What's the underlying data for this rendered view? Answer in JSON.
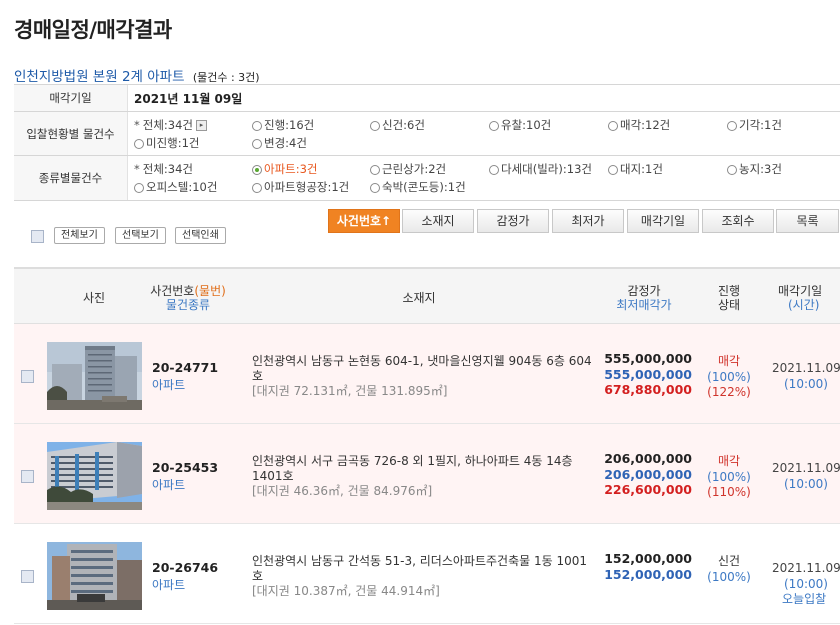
{
  "page_title": "경매일정/매각결과",
  "court": {
    "name": "인천지방법원 본원 2계 아파트",
    "count_note": "(물건수 : 3건)"
  },
  "filters": {
    "date_label": "매각기일",
    "date_value": "2021년 11월 09일",
    "status_label": "입찰현황별 물건수",
    "status_options": [
      {
        "label": "전체:34건",
        "kind": "total"
      },
      {
        "label": "진행:16건",
        "kind": "radio"
      },
      {
        "label": "신건:6건",
        "kind": "radio"
      },
      {
        "label": "유찰:10건",
        "kind": "radio"
      },
      {
        "label": "매각:12건",
        "kind": "radio"
      },
      {
        "label": "기각:1건",
        "kind": "radio"
      },
      {
        "label": "미진행:1건",
        "kind": "radio"
      },
      {
        "label": "변경:4건",
        "kind": "radio"
      }
    ],
    "type_label": "종류별물건수",
    "type_options": [
      {
        "label": "전체:34건",
        "kind": "total"
      },
      {
        "label": "아파트:3건",
        "kind": "radio",
        "selected": true
      },
      {
        "label": "근린상가:2건",
        "kind": "radio"
      },
      {
        "label": "다세대(빌라):13건",
        "kind": "radio"
      },
      {
        "label": "대지:1건",
        "kind": "radio"
      },
      {
        "label": "농지:3건",
        "kind": "radio"
      },
      {
        "label": "오피스텔:10건",
        "kind": "radio"
      },
      {
        "label": "아파트형공장:1건",
        "kind": "radio"
      },
      {
        "label": "숙박(콘도등):1건",
        "kind": "radio"
      }
    ]
  },
  "toolbar": {
    "view_all": "전체보기",
    "view_selected": "선택보기",
    "print_selected": "선택인쇄",
    "sort_buttons": [
      "사건번호↑",
      "소재지",
      "감정가",
      "최저가",
      "매각기일",
      "조회수",
      "목록"
    ]
  },
  "list_header": {
    "photo": "사진",
    "case_no": "사건번호",
    "item_no": "(물번)",
    "item_type": "물건종류",
    "address": "소재지",
    "appraisal": "감정가",
    "min_price": "최저매각가",
    "progress_1": "진행",
    "progress_2": "상태",
    "sale_date": "매각기일",
    "time": "(시간)"
  },
  "rows": [
    {
      "case_no": "20-24771",
      "type": "아파트",
      "address": "인천광역시 남동구 논현동 604-1, 냇마을신영지웰 904동 6층 604호",
      "area": "[대지권 72.131㎡, 건물 131.895㎡]",
      "appraisal": "555,000,000",
      "min_price": "555,000,000",
      "sold_price": "678,880,000",
      "status": "매각",
      "rate1": "(100%)",
      "rate2": "(122%)",
      "date": "2021.11.09",
      "time": "(10:00)",
      "today": ""
    },
    {
      "case_no": "20-25453",
      "type": "아파트",
      "address": "인천광역시 서구 금곡동 726-8 외 1필지, 하나아파트 4동 14층 1401호",
      "area": "[대지권 46.36㎡, 건물 84.976㎡]",
      "appraisal": "206,000,000",
      "min_price": "206,000,000",
      "sold_price": "226,600,000",
      "status": "매각",
      "rate1": "(100%)",
      "rate2": "(110%)",
      "date": "2021.11.09",
      "time": "(10:00)",
      "today": ""
    },
    {
      "case_no": "20-26746",
      "type": "아파트",
      "address": "인천광역시 남동구 간석동 51-3, 리더스아파트주건축물 1동 1001호",
      "area": "[대지권 10.387㎡, 건물 44.914㎡]",
      "appraisal": "152,000,000",
      "min_price": "152,000,000",
      "sold_price": "",
      "status": "신건",
      "rate1": "(100%)",
      "rate2": "",
      "date": "2021.11.09",
      "time": "(10:00)",
      "today": "오늘입찰"
    }
  ]
}
